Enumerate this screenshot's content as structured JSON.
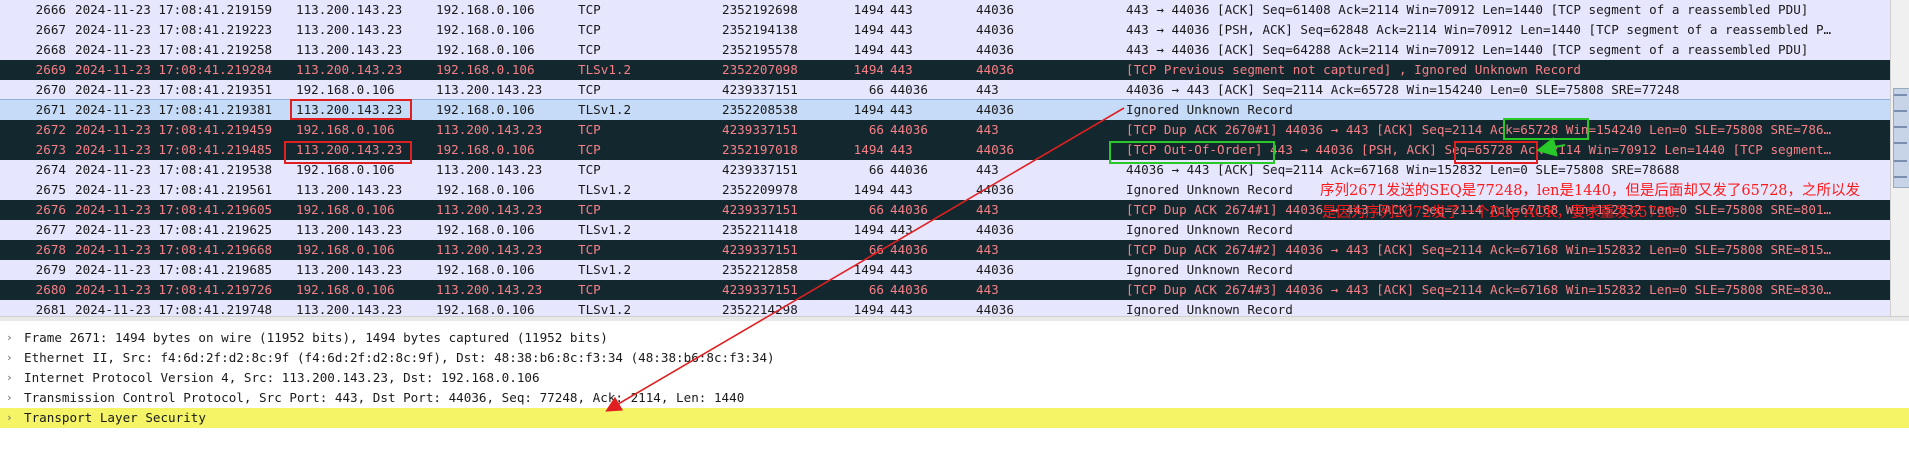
{
  "packet_list": {
    "rows": [
      {
        "no": "2666",
        "time": "2024-11-23 17:08:41.219159",
        "src": "113.200.143.23",
        "dst": "192.168.0.106",
        "proto": "TCP",
        "seq": "2352192698",
        "len": "1494",
        "sport": "443",
        "dport": "44036",
        "info": "443 → 44036 [ACK] Seq=61408 Ack=2114 Win=70912 Len=1440 [TCP segment of a reassembled PDU]",
        "style": "normal"
      },
      {
        "no": "2667",
        "time": "2024-11-23 17:08:41.219223",
        "src": "113.200.143.23",
        "dst": "192.168.0.106",
        "proto": "TCP",
        "seq": "2352194138",
        "len": "1494",
        "sport": "443",
        "dport": "44036",
        "info": "443 → 44036 [PSH, ACK] Seq=62848 Ack=2114 Win=70912 Len=1440 [TCP segment of a reassembled P…",
        "style": "normal"
      },
      {
        "no": "2668",
        "time": "2024-11-23 17:08:41.219258",
        "src": "113.200.143.23",
        "dst": "192.168.0.106",
        "proto": "TCP",
        "seq": "2352195578",
        "len": "1494",
        "sport": "443",
        "dport": "44036",
        "info": "443 → 44036 [ACK] Seq=64288 Ack=2114 Win=70912 Len=1440 [TCP segment of a reassembled PDU]",
        "style": "normal"
      },
      {
        "no": "2669",
        "time": "2024-11-23 17:08:41.219284",
        "src": "113.200.143.23",
        "dst": "192.168.0.106",
        "proto": "TLSv1.2",
        "seq": "2352207098",
        "len": "1494",
        "sport": "443",
        "dport": "44036",
        "info": "[TCP Previous segment not captured] , Ignored Unknown Record",
        "style": "bad"
      },
      {
        "no": "2670",
        "time": "2024-11-23 17:08:41.219351",
        "src": "192.168.0.106",
        "dst": "113.200.143.23",
        "proto": "TCP",
        "seq": "4239337151",
        "len": "66",
        "sport": "44036",
        "dport": "443",
        "info": "44036 → 443 [ACK] Seq=2114 Ack=65728 Win=154240 Len=0 SLE=75808 SRE=77248",
        "style": "normal"
      },
      {
        "no": "2671",
        "time": "2024-11-23 17:08:41.219381",
        "src": "113.200.143.23",
        "dst": "192.168.0.106",
        "proto": "TLSv1.2",
        "seq": "2352208538",
        "len": "1494",
        "sport": "443",
        "dport": "44036",
        "info": "Ignored Unknown Record",
        "style": "selected"
      },
      {
        "no": "2672",
        "time": "2024-11-23 17:08:41.219459",
        "src": "192.168.0.106",
        "dst": "113.200.143.23",
        "proto": "TCP",
        "seq": "4239337151",
        "len": "66",
        "sport": "44036",
        "dport": "443",
        "info": "[TCP Dup ACK 2670#1] 44036 → 443 [ACK] Seq=2114 Ack=65728 Win=154240 Len=0 SLE=75808 SRE=786…",
        "style": "bad"
      },
      {
        "no": "2673",
        "time": "2024-11-23 17:08:41.219485",
        "src": "113.200.143.23",
        "dst": "192.168.0.106",
        "proto": "TCP",
        "seq": "2352197018",
        "len": "1494",
        "sport": "443",
        "dport": "44036",
        "info": "[TCP Out-Of-Order] 443 → 44036 [PSH, ACK] Seq=65728 Ack=2114 Win=70912 Len=1440 [TCP segment…",
        "style": "bad"
      },
      {
        "no": "2674",
        "time": "2024-11-23 17:08:41.219538",
        "src": "192.168.0.106",
        "dst": "113.200.143.23",
        "proto": "TCP",
        "seq": "4239337151",
        "len": "66",
        "sport": "44036",
        "dport": "443",
        "info": "44036 → 443 [ACK] Seq=2114 Ack=67168 Win=152832 Len=0 SLE=75808 SRE=78688",
        "style": "normal"
      },
      {
        "no": "2675",
        "time": "2024-11-23 17:08:41.219561",
        "src": "113.200.143.23",
        "dst": "192.168.0.106",
        "proto": "TLSv1.2",
        "seq": "2352209978",
        "len": "1494",
        "sport": "443",
        "dport": "44036",
        "info": "Ignored Unknown Record",
        "style": "normal"
      },
      {
        "no": "2676",
        "time": "2024-11-23 17:08:41.219605",
        "src": "192.168.0.106",
        "dst": "113.200.143.23",
        "proto": "TCP",
        "seq": "4239337151",
        "len": "66",
        "sport": "44036",
        "dport": "443",
        "info": "[TCP Dup ACK 2674#1] 44036 → 443 [ACK] Seq=2114 Ack=67168 Win=152832 Len=0 SLE=75808 SRE=801…",
        "style": "bad"
      },
      {
        "no": "2677",
        "time": "2024-11-23 17:08:41.219625",
        "src": "113.200.143.23",
        "dst": "192.168.0.106",
        "proto": "TLSv1.2",
        "seq": "2352211418",
        "len": "1494",
        "sport": "443",
        "dport": "44036",
        "info": "Ignored Unknown Record",
        "style": "normal"
      },
      {
        "no": "2678",
        "time": "2024-11-23 17:08:41.219668",
        "src": "192.168.0.106",
        "dst": "113.200.143.23",
        "proto": "TCP",
        "seq": "4239337151",
        "len": "66",
        "sport": "44036",
        "dport": "443",
        "info": "[TCP Dup ACK 2674#2] 44036 → 443 [ACK] Seq=2114 Ack=67168 Win=152832 Len=0 SLE=75808 SRE=815…",
        "style": "bad"
      },
      {
        "no": "2679",
        "time": "2024-11-23 17:08:41.219685",
        "src": "113.200.143.23",
        "dst": "192.168.0.106",
        "proto": "TLSv1.2",
        "seq": "2352212858",
        "len": "1494",
        "sport": "443",
        "dport": "44036",
        "info": "Ignored Unknown Record",
        "style": "normal"
      },
      {
        "no": "2680",
        "time": "2024-11-23 17:08:41.219726",
        "src": "192.168.0.106",
        "dst": "113.200.143.23",
        "proto": "TCP",
        "seq": "4239337151",
        "len": "66",
        "sport": "44036",
        "dport": "443",
        "info": "[TCP Dup ACK 2674#3] 44036 → 443 [ACK] Seq=2114 Ack=67168 Win=152832 Len=0 SLE=75808 SRE=830…",
        "style": "bad"
      },
      {
        "no": "2681",
        "time": "2024-11-23 17:08:41.219748",
        "src": "113.200.143.23",
        "dst": "192.168.0.106",
        "proto": "TLSv1.2",
        "seq": "2352214298",
        "len": "1494",
        "sport": "443",
        "dport": "44036",
        "info": "Ignored Unknown Record",
        "style": "normal"
      }
    ]
  },
  "details": {
    "items": [
      {
        "label": "Frame 2671: 1494 bytes on wire (11952 bits), 1494 bytes captured (11952 bits)",
        "arrow": "›"
      },
      {
        "label": "Ethernet II, Src: f4:6d:2f:d2:8c:9f (f4:6d:2f:d2:8c:9f), Dst: 48:38:b6:8c:f3:34 (48:38:b6:8c:f3:34)",
        "arrow": "›"
      },
      {
        "label": "Internet Protocol Version 4, Src: 113.200.143.23, Dst: 192.168.0.106",
        "arrow": "›"
      },
      {
        "label": "Transmission Control Protocol, Src Port: 443, Dst Port: 44036, Seq: 77248, Ack: 2114, Len: 1440",
        "arrow": "›"
      },
      {
        "label": "Transport Layer Security",
        "arrow": "›"
      }
    ]
  },
  "annotation": {
    "line1": "序列2671发送的SEQ是77248，len是1440，但是后面却又发了65728，之所以发",
    "line2": "是因为序列2672发了一个Dup ACK，要求重发65728."
  },
  "colors": {
    "row_normal_bg": "#e7e6ff",
    "row_bad_bg": "#12272e",
    "row_bad_text": "#f78087",
    "row_selected_bg": "#c6dbf8",
    "highlight_yellow": "#f4f466",
    "annotation_red": "#ff1a1a",
    "box_green": "#28c828"
  }
}
